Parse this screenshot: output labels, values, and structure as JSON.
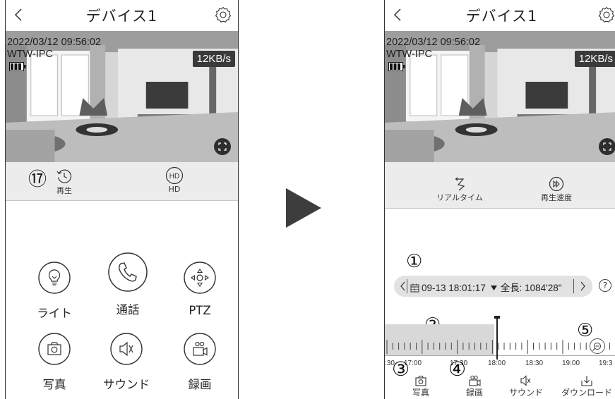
{
  "left": {
    "title": "デバイス1",
    "timestamp": "2022/03/12 09:56:02",
    "camera_name": "WTW-IPC",
    "bitrate": "12KB/s",
    "toolbar": {
      "playback_label": "再生",
      "hd_icon_text": "HD",
      "hd_label": "HD",
      "badge": "⑰"
    },
    "controls": [
      {
        "label": "ライト",
        "icon": "bulb-icon"
      },
      {
        "label": "通話",
        "icon": "phone-icon"
      },
      {
        "label": "PTZ",
        "icon": "ptz-icon"
      },
      {
        "label": "写真",
        "icon": "camera-icon"
      },
      {
        "label": "サウンド",
        "icon": "speaker-mute-icon"
      },
      {
        "label": "録画",
        "icon": "video-record-icon"
      }
    ]
  },
  "right": {
    "title": "デバイス1",
    "timestamp": "2022/03/12 09:56:02",
    "camera_name": "WTW-IPC",
    "bitrate": "12KB/s",
    "toolbar": {
      "realtime_label": "リアルタイム",
      "speed_label": "再生速度"
    },
    "playback": {
      "date_time": "09-13 18:01:17",
      "total_label": "全長: 1084'28\"",
      "help": "?"
    },
    "timeline": {
      "labels": [
        ":30",
        "17:00",
        "17:30",
        "18:00",
        "18:30",
        "19:00",
        "19:3"
      ]
    },
    "bottom_bar": [
      {
        "label": "写真",
        "icon": "camera-icon"
      },
      {
        "label": "録画",
        "icon": "video-record-icon"
      },
      {
        "label": "サウンド",
        "icon": "speaker-mute-icon"
      },
      {
        "label": "ダウンロード",
        "icon": "download-icon"
      }
    ],
    "badges": [
      "①",
      "②",
      "③",
      "④",
      "⑤"
    ]
  }
}
